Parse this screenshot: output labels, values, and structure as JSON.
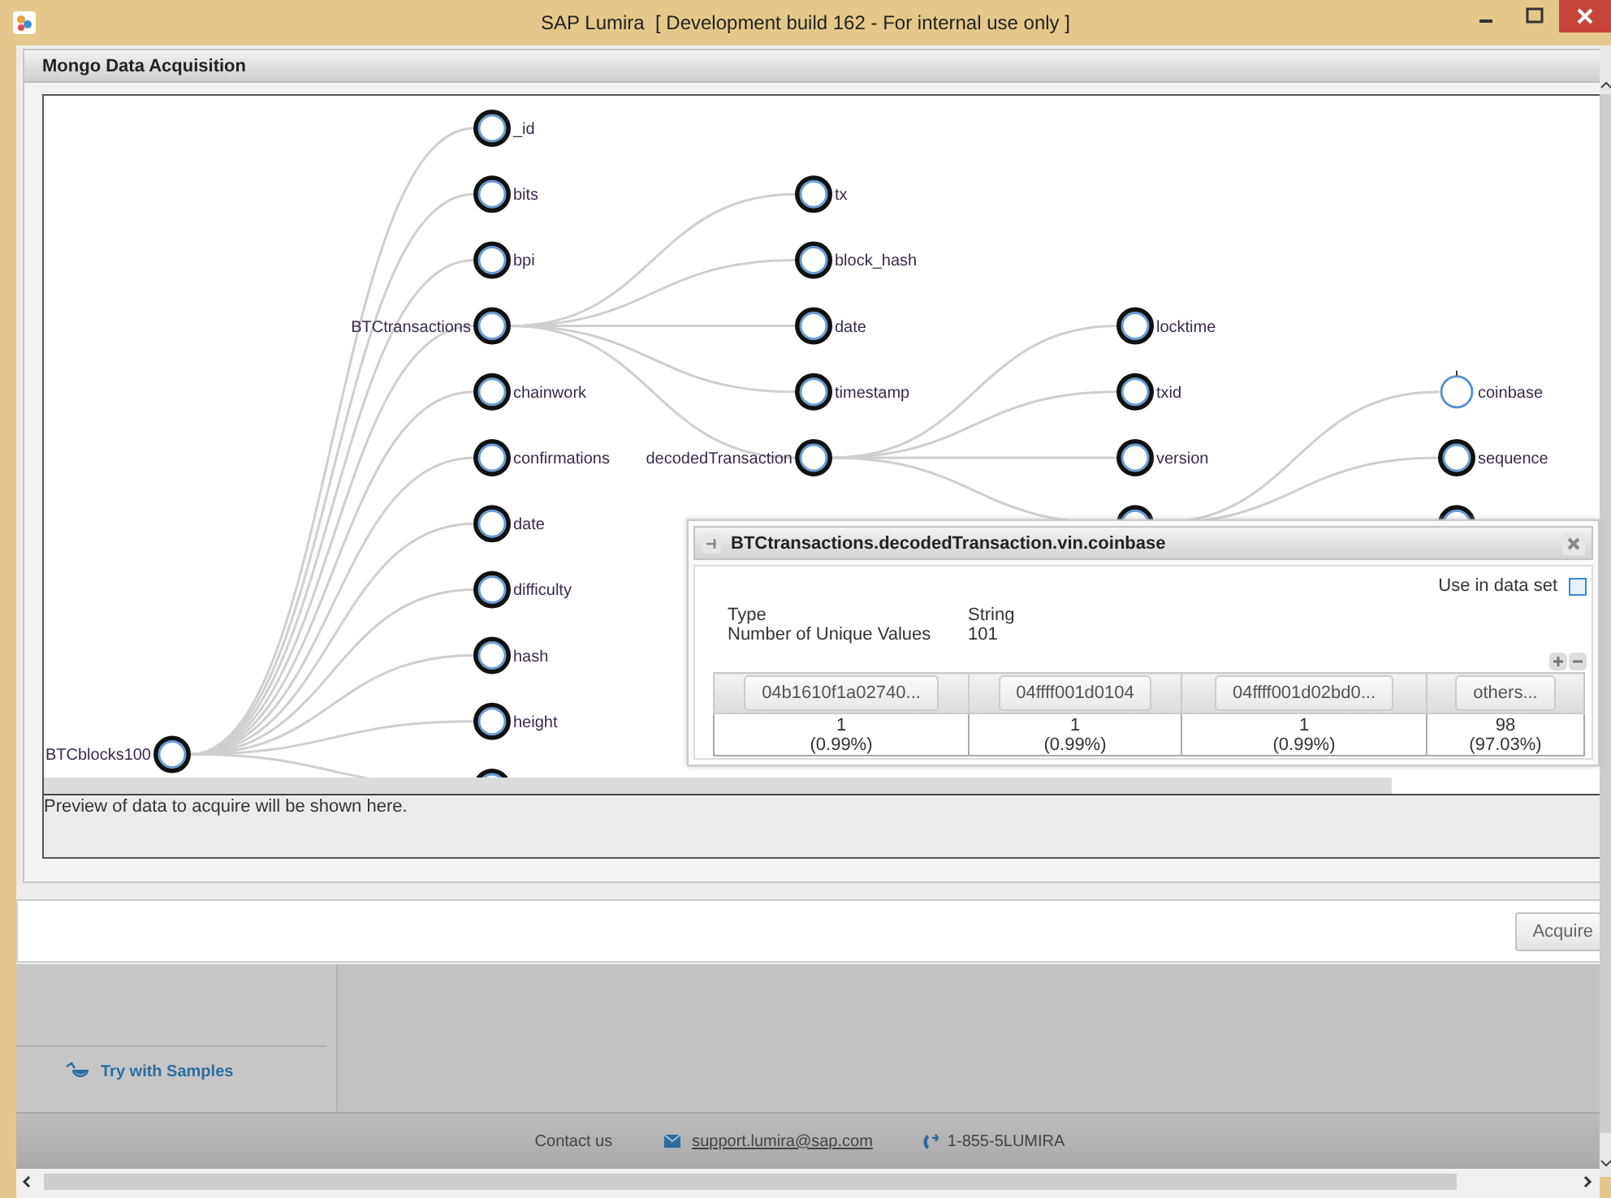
{
  "window": {
    "title": "SAP Lumira  [ Development build 162 - For internal use only ]"
  },
  "panel": {
    "title": "Mongo Data Acquisition"
  },
  "tree": {
    "root": {
      "label": "BTCblocks100",
      "selected": false,
      "children": [
        {
          "label": "_id",
          "selected": false
        },
        {
          "label": "bits",
          "selected": false
        },
        {
          "label": "bpi",
          "selected": false
        },
        {
          "label": "BTCtransactions",
          "selected": false,
          "children": [
            {
              "label": "tx",
              "selected": false
            },
            {
              "label": "block_hash",
              "selected": false
            },
            {
              "label": "date",
              "selected": false
            },
            {
              "label": "timestamp",
              "selected": false
            },
            {
              "label": "decodedTransaction",
              "selected": false,
              "children": [
                {
                  "label": "locktime",
                  "selected": false
                },
                {
                  "label": "txid",
                  "selected": false
                },
                {
                  "label": "version",
                  "selected": false
                },
                {
                  "selected": false,
                  "children": [
                    {
                      "label": "coinbase",
                      "selected": true
                    },
                    {
                      "label": "sequence",
                      "selected": false
                    },
                    {
                      "selected": false
                    }
                  ]
                }
              ]
            }
          ]
        },
        {
          "label": "chainwork",
          "selected": false
        },
        {
          "label": "confirmations",
          "selected": false
        },
        {
          "label": "date",
          "selected": false
        },
        {
          "label": "difficulty",
          "selected": false
        },
        {
          "label": "hash",
          "selected": false
        },
        {
          "label": "height",
          "selected": false
        },
        {
          "selected": false
        }
      ]
    }
  },
  "preview": {
    "text": "Preview of data to acquire will be shown here."
  },
  "popup": {
    "title": "BTCtransactions.decodedTransaction.vin.coinbase",
    "use_in_data_set": {
      "label": "Use in data set",
      "checked": false
    },
    "properties": [
      {
        "name": "Type",
        "value": "String"
      },
      {
        "name": "Number of Unique Values",
        "value": "101"
      }
    ],
    "columns": [
      {
        "value": "04b1610f1a02740...",
        "count": "1",
        "percent": "(0.99%)"
      },
      {
        "value": "04ffff001d0104",
        "count": "1",
        "percent": "(0.99%)"
      },
      {
        "value": "04ffff001d02bd0...",
        "count": "1",
        "percent": "(0.99%)"
      },
      {
        "value": "others...",
        "count": "98",
        "percent": "(97.03%)"
      }
    ]
  },
  "acquire_button": "Acquire",
  "samples_link": "Try with Samples",
  "footer": {
    "contact_label": "Contact us",
    "email": "support.lumira@sap.com",
    "phone": "1-855-5LUMIRA"
  }
}
